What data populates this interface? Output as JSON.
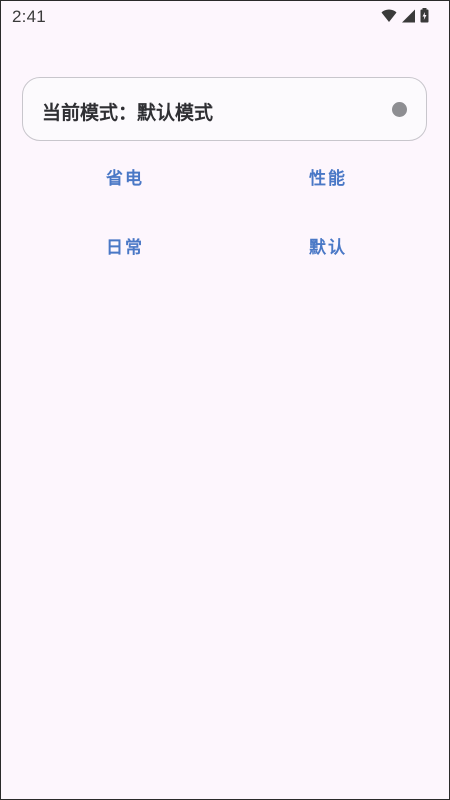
{
  "status_bar": {
    "time": "2:41",
    "icons": [
      "wifi-icon",
      "cellular-signal-icon",
      "battery-charging-icon"
    ]
  },
  "mode_card": {
    "label": "当前模式：默认模式",
    "indicator_color": "#8e8e92"
  },
  "mode_buttons": {
    "power_saving": "省电",
    "performance": "性能",
    "daily": "日常",
    "default": "默认"
  },
  "colors": {
    "background": "#fdf6fd",
    "accent": "#4a78c6",
    "text_primary": "#2f2f33"
  }
}
